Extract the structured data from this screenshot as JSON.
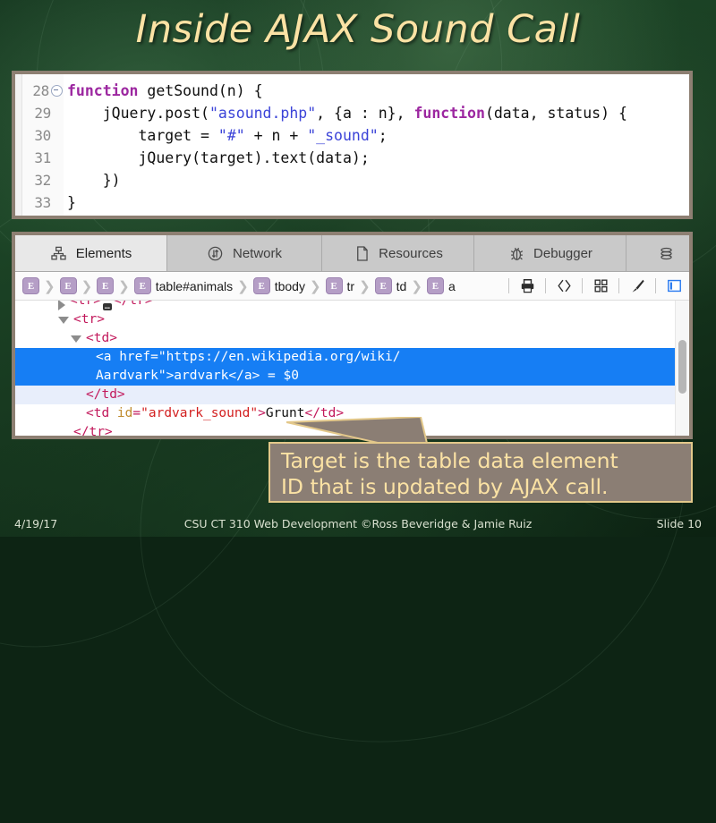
{
  "slide": {
    "title": "Inside AJAX Sound Call"
  },
  "code_panel": {
    "lines": [
      {
        "num": "28",
        "fold": true,
        "tokens": [
          {
            "t": "function ",
            "c": "kw"
          },
          {
            "t": "getSound(n) {",
            "c": "plain"
          }
        ]
      },
      {
        "num": "29",
        "fold": false,
        "tokens": [
          {
            "t": "    jQuery.post(",
            "c": "plain"
          },
          {
            "t": "\"asound.php\"",
            "c": "str"
          },
          {
            "t": ", {a : n}, ",
            "c": "plain"
          },
          {
            "t": "function",
            "c": "kw"
          },
          {
            "t": "(data, status) {",
            "c": "plain"
          }
        ]
      },
      {
        "num": "30",
        "fold": false,
        "tokens": [
          {
            "t": "        target = ",
            "c": "plain"
          },
          {
            "t": "\"#\"",
            "c": "str"
          },
          {
            "t": " + n + ",
            "c": "plain"
          },
          {
            "t": "\"_sound\"",
            "c": "str"
          },
          {
            "t": ";",
            "c": "plain"
          }
        ]
      },
      {
        "num": "31",
        "fold": false,
        "tokens": [
          {
            "t": "        jQuery(target).text(data);",
            "c": "plain"
          }
        ]
      },
      {
        "num": "32",
        "fold": false,
        "tokens": [
          {
            "t": "    })",
            "c": "plain"
          }
        ]
      },
      {
        "num": "33",
        "fold": false,
        "tokens": [
          {
            "t": "}",
            "c": "plain"
          }
        ]
      }
    ]
  },
  "devtools": {
    "tabs": [
      {
        "label": "Elements",
        "icon": "sitemap-icon",
        "active": true
      },
      {
        "label": "Network",
        "icon": "network-icon",
        "active": false
      },
      {
        "label": "Resources",
        "icon": "document-icon",
        "active": false
      },
      {
        "label": "Debugger",
        "icon": "bug-icon",
        "active": false
      },
      {
        "label": "",
        "icon": "database-icon",
        "active": false
      }
    ],
    "breadcrumb": [
      {
        "badge": "E",
        "label": ""
      },
      {
        "badge": "E",
        "label": ""
      },
      {
        "badge": "E",
        "label": ""
      },
      {
        "badge": "E",
        "label": "table#animals"
      },
      {
        "badge": "E",
        "label": "tbody"
      },
      {
        "badge": "E",
        "label": "tr"
      },
      {
        "badge": "E",
        "label": "td"
      },
      {
        "badge": "E",
        "label": "a"
      }
    ],
    "toolbar_icons": [
      "print-icon",
      "code-brackets-icon",
      "grid-icon",
      "paintbrush-icon",
      "panel-toggle-icon"
    ],
    "dom_rows": [
      {
        "type": "clipped",
        "indent": 3,
        "triangle": "collapsed",
        "parts": [
          {
            "t": "<tr>",
            "c": "tag"
          },
          {
            "t": "ELLIPSIS",
            "c": "ell"
          },
          {
            "t": "</tr>",
            "c": "tag"
          }
        ]
      },
      {
        "type": "normal",
        "indent": 3,
        "triangle": "expanded",
        "parts": [
          {
            "t": "<tr>",
            "c": "tag"
          }
        ]
      },
      {
        "type": "normal",
        "indent": 4,
        "triangle": "expanded",
        "parts": [
          {
            "t": "<td>",
            "c": "tag"
          }
        ]
      },
      {
        "type": "selected",
        "indent": 6,
        "triangle": "none",
        "line1": "<a href=\"https://en.wikipedia.org/wiki/",
        "line2": "Aardvark\">ardvark</a> = $0"
      },
      {
        "type": "parent",
        "indent": 4,
        "triangle": "none",
        "parts": [
          {
            "t": "</td>",
            "c": "tag"
          }
        ]
      },
      {
        "type": "normal",
        "indent": 4,
        "triangle": "none",
        "parts": [
          {
            "t": "<td ",
            "c": "tag"
          },
          {
            "t": "id",
            "c": "attr"
          },
          {
            "t": "=",
            "c": "tag"
          },
          {
            "t": "\"ardvark_sound\"",
            "c": "val"
          },
          {
            "t": ">",
            "c": "tag"
          },
          {
            "t": "Grunt",
            "c": "txt"
          },
          {
            "t": "</td>",
            "c": "tag"
          }
        ]
      },
      {
        "type": "normal",
        "indent": 3,
        "triangle": "none",
        "parts": [
          {
            "t": "</tr>",
            "c": "tag"
          }
        ]
      }
    ]
  },
  "callout": {
    "line1": "Target is the table data element",
    "line2": "ID that is updated by AJAX call."
  },
  "footer": {
    "date": "4/19/17",
    "center": "CSU CT 310 Web Development ©Ross Beveridge & Jamie Ruiz",
    "slide": "Slide 10"
  },
  "colors": {
    "title": "#fbe2a4",
    "panel_border": "#8d7f72",
    "selection_blue": "#167ef4",
    "callout_bg": "#8b7e74",
    "callout_border": "#e3c88a",
    "keyword": "#9c27a0",
    "string": "#3b43d8",
    "tag": "#c2185b",
    "attr_name": "#bf8b2e",
    "attr_value": "#d32020"
  }
}
